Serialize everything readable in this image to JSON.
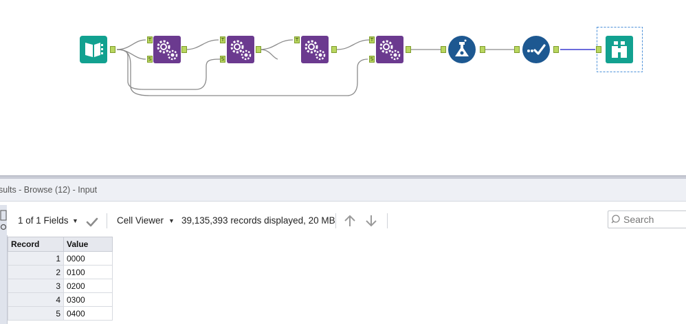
{
  "workflow": {
    "tools": [
      {
        "name": "input-data-tool",
        "icon": "book-icon",
        "color": "#12a190"
      },
      {
        "name": "batch-macro-tool-1",
        "icon": "gears-icon",
        "color": "#6b3a8f"
      },
      {
        "name": "batch-macro-tool-2",
        "icon": "gears-icon",
        "color": "#6b3a8f"
      },
      {
        "name": "batch-macro-tool-3",
        "icon": "gears-icon",
        "color": "#6b3a8f"
      },
      {
        "name": "batch-macro-tool-4",
        "icon": "gears-icon",
        "color": "#6b3a8f"
      },
      {
        "name": "formula-tool",
        "icon": "flask-icon",
        "color": "#1d5891"
      },
      {
        "name": "select-records-tool",
        "icon": "check-dots-icon",
        "color": "#1d5891"
      },
      {
        "name": "browse-tool",
        "icon": "binoculars-icon",
        "color": "#12a190"
      }
    ],
    "anchor_labels": {
      "top": "T",
      "bottom": "S"
    }
  },
  "results": {
    "title": "sults - Browse (12) - Input",
    "toolbar": {
      "fields_label": "1 of 1 Fields",
      "cell_viewer_label": "Cell Viewer",
      "records_info": "39,135,393 records displayed, 20 MB",
      "search_placeholder": "Search"
    },
    "table": {
      "headers": [
        "Record",
        "Value"
      ],
      "rows": [
        {
          "record": "1",
          "value": "0000"
        },
        {
          "record": "2",
          "value": "0100"
        },
        {
          "record": "3",
          "value": "0200"
        },
        {
          "record": "4",
          "value": "0300"
        },
        {
          "record": "5",
          "value": "0400"
        }
      ]
    }
  },
  "colors": {
    "teal_tool": "#12a190",
    "purple_tool": "#6b3a8f",
    "blue_tool": "#1d5891",
    "anchor_green": "#b9d65f",
    "connection_gray": "#8a8a8a",
    "connection_selected": "#3b3bd0",
    "selection_border": "#4a8fd8"
  }
}
